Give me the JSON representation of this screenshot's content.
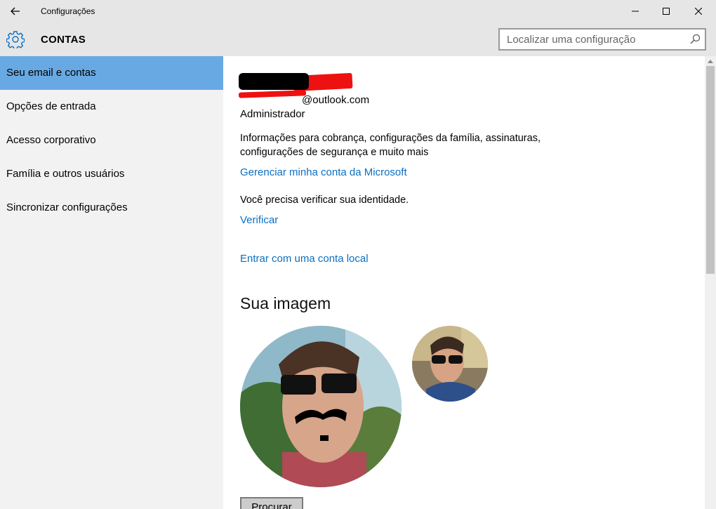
{
  "window": {
    "title": "Configurações"
  },
  "header": {
    "section_title": "CONTAS",
    "search_placeholder": "Localizar uma configuração"
  },
  "sidebar": {
    "items": [
      {
        "label": "Seu email e contas",
        "active": true
      },
      {
        "label": "Opções de entrada",
        "active": false
      },
      {
        "label": "Acesso corporativo",
        "active": false
      },
      {
        "label": "Família e outros usuários",
        "active": false
      },
      {
        "label": "Sincronizar configurações",
        "active": false
      }
    ]
  },
  "account": {
    "email_suffix": "@outlook.com",
    "role": "Administrador",
    "info_line1": "Informações para cobrança, configurações da família, assinaturas,",
    "info_line2": "configurações de segurança e muito mais",
    "manage_link": "Gerenciar minha conta da Microsoft",
    "verify_text": "Você precisa verificar sua identidade.",
    "verify_link": "Verificar",
    "local_account_link": "Entrar com uma conta local"
  },
  "picture": {
    "heading": "Sua imagem",
    "browse_button": "Procurar"
  },
  "colors": {
    "accent": "#68a9e3",
    "link": "#0b6fc2",
    "titlebar": "#e6e6e6",
    "sidebar": "#f2f2f2"
  }
}
